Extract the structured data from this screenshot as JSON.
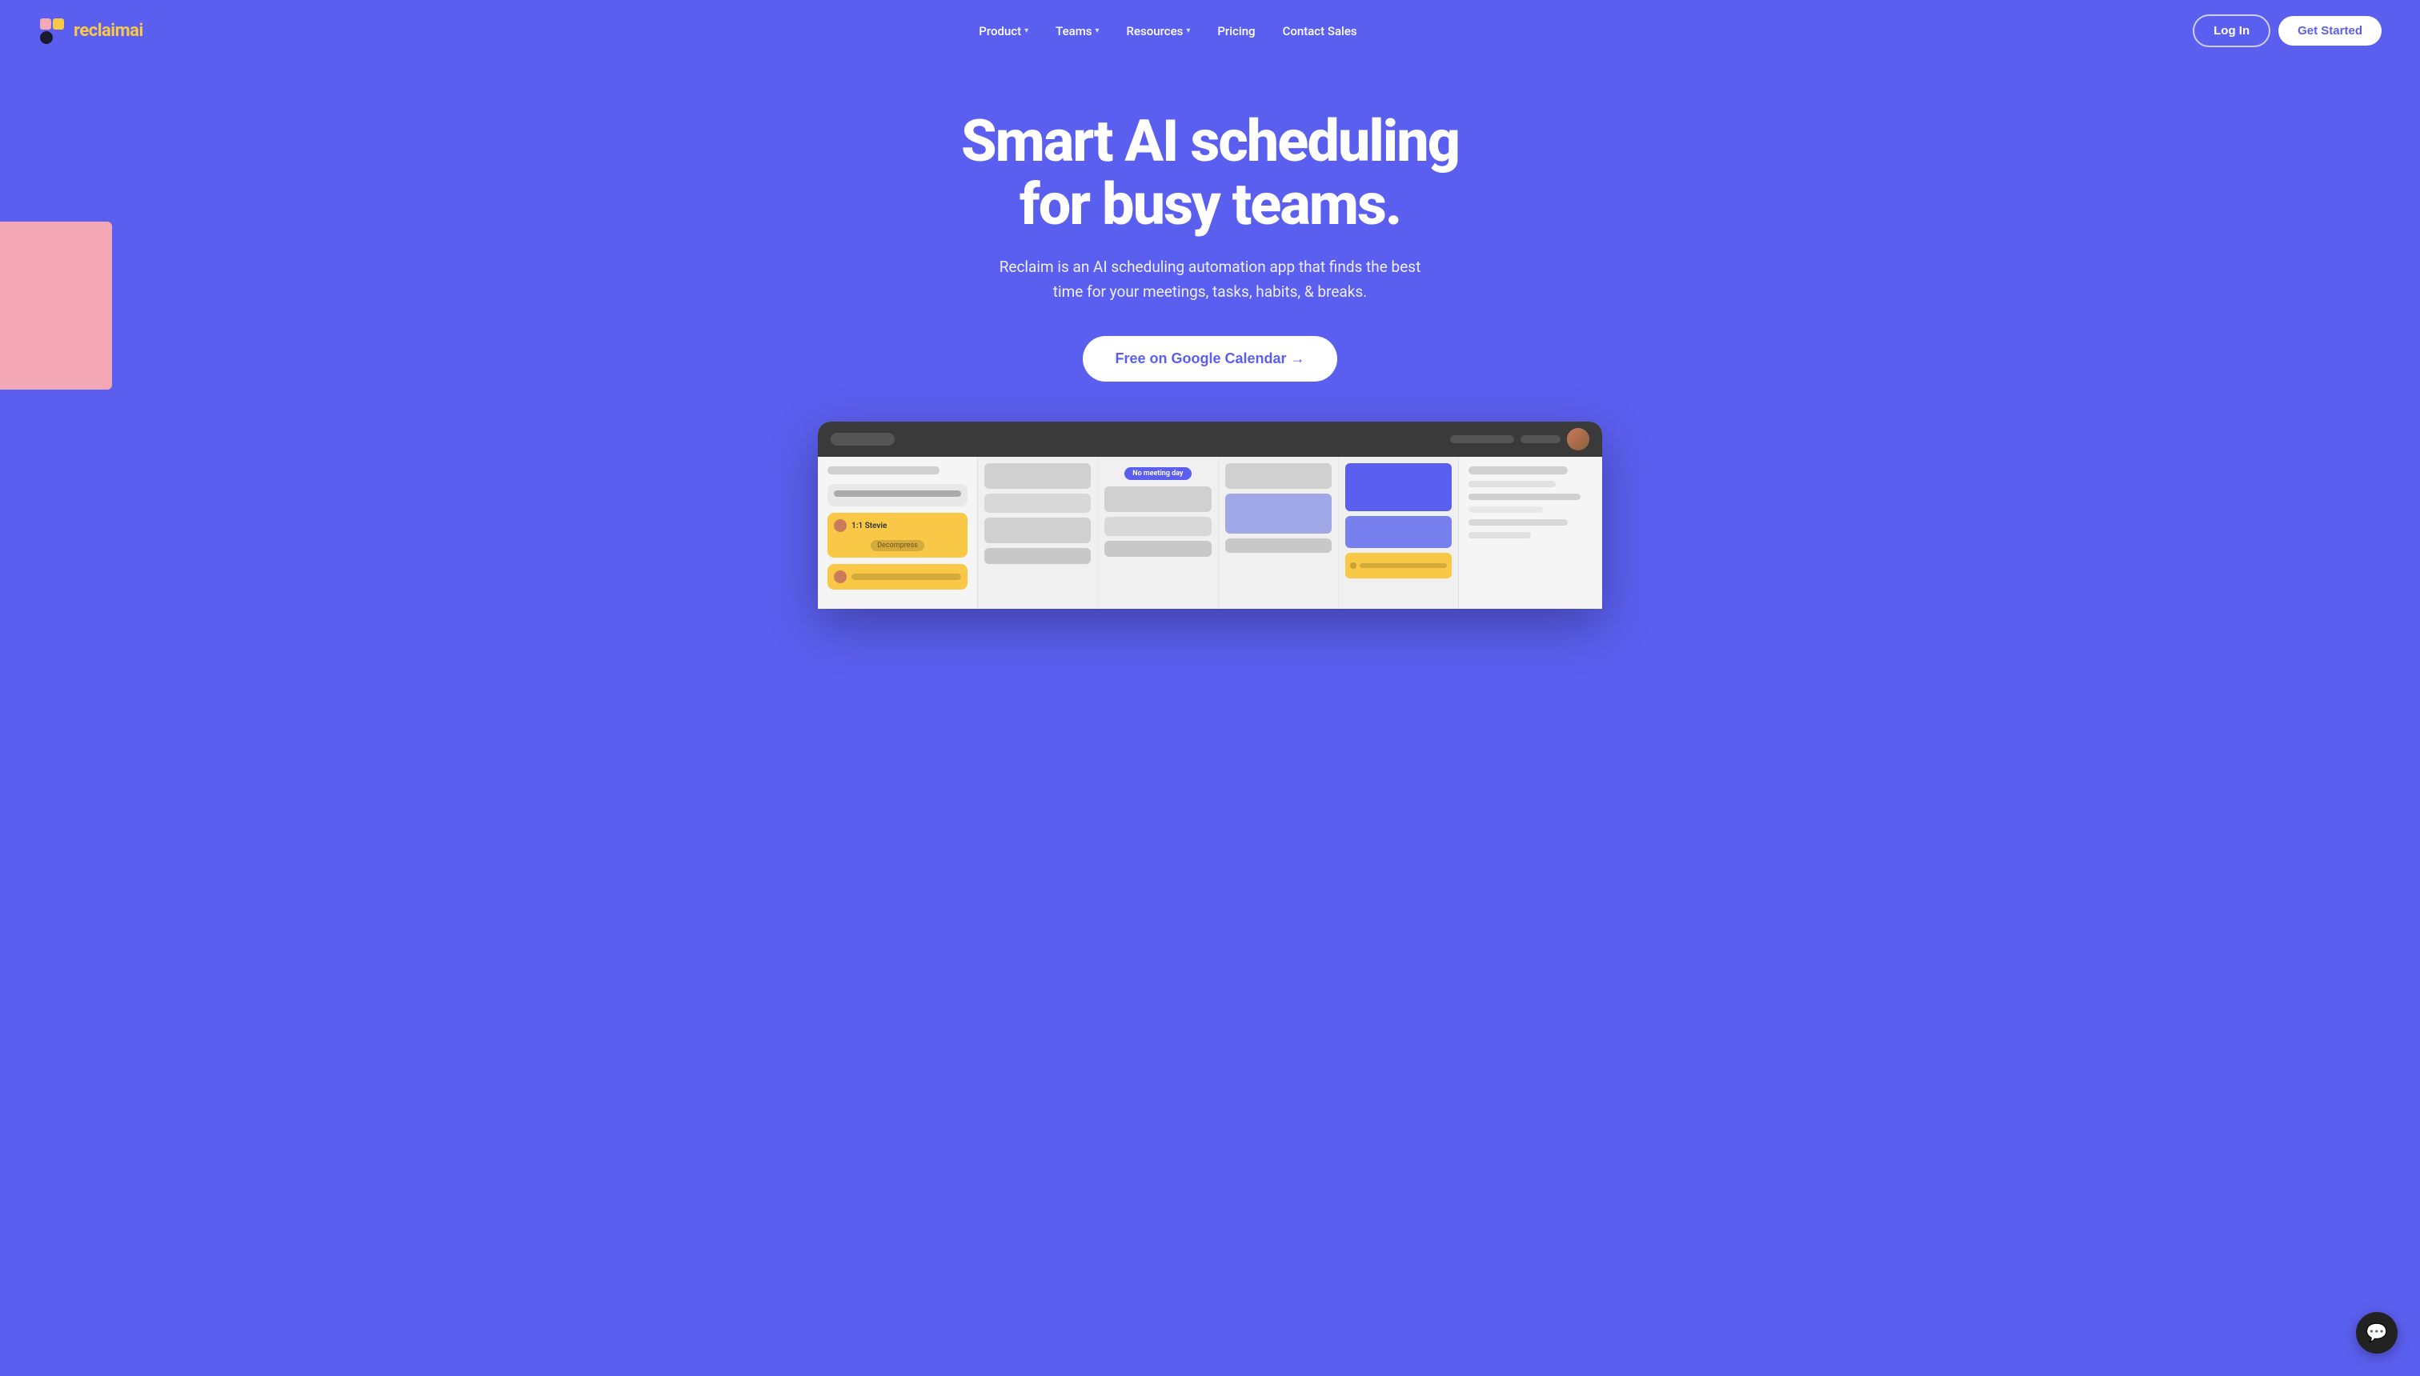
{
  "brand": {
    "name_prefix": "reclaim",
    "name_suffix": "ai",
    "logo_alt": "Reclaim AI Logo"
  },
  "nav": {
    "links": [
      {
        "label": "Product",
        "has_dropdown": true
      },
      {
        "label": "Teams",
        "has_dropdown": true
      },
      {
        "label": "Resources",
        "has_dropdown": true
      },
      {
        "label": "Pricing",
        "has_dropdown": false
      },
      {
        "label": "Contact Sales",
        "has_dropdown": false
      }
    ],
    "login_label": "Log In",
    "get_started_label": "Get Started"
  },
  "hero": {
    "title_line1": "Smart AI scheduling",
    "title_line2": "for busy teams.",
    "subtitle": "Reclaim is an AI scheduling automation app that finds the best time for your meetings, tasks, habits, & breaks.",
    "cta_label": "Free on Google Calendar →"
  },
  "app_preview": {
    "no_meeting_badge": "No meeting day",
    "calendar_event_1": "1:1 Stevie",
    "calendar_event_2": "Decompress"
  },
  "chat_widget": {
    "icon": "💬"
  }
}
